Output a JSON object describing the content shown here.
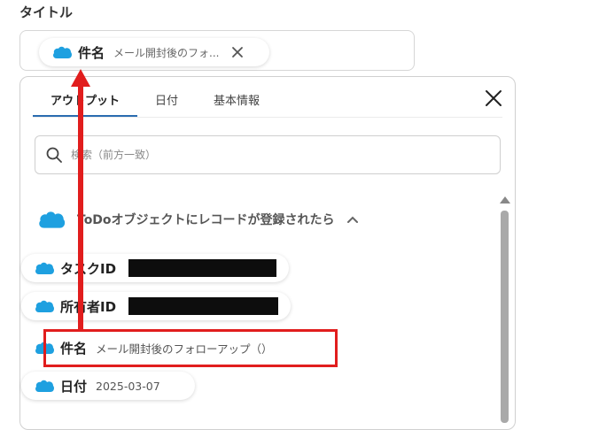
{
  "title_label": "タイトル",
  "selected_field": {
    "label": "件名",
    "value": "メール開封後のフォ..."
  },
  "panel": {
    "tabs": [
      {
        "label": "アウトプット",
        "active": true
      },
      {
        "label": "日付",
        "active": false
      },
      {
        "label": "基本情報",
        "active": false
      }
    ],
    "search": {
      "placeholder": "検索（前方一致）"
    },
    "section": {
      "title": "ToDoオブジェクトにレコードが登録されたら"
    },
    "items": [
      {
        "label": "タスクID",
        "value": ""
      },
      {
        "label": "所有者ID",
        "value": ""
      },
      {
        "label": "件名",
        "value": "メール開封後のフォローアップ（）"
      },
      {
        "label": "日付",
        "value": "2025-03-07"
      }
    ]
  },
  "colors": {
    "accent": "#2b6cb0",
    "salesforce_blue": "#1ea0e0",
    "annotation_red": "#e11d1d"
  },
  "icons": [
    "salesforce-cloud-icon",
    "close-icon",
    "search-icon",
    "chevron-up-icon",
    "scroll-up-icon"
  ]
}
